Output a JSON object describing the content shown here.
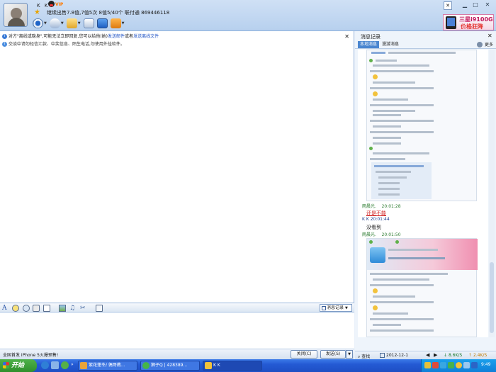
{
  "header": {
    "nickname": "K K",
    "vip_label": "VIP",
    "status_text": "继续出售7.8值,7值5次 8值5/40个 联付通 869446118",
    "toolbar_icons": [
      "video-icon",
      "voice-icon",
      "file-transfer-icon",
      "remote-assist-icon",
      "screen-share-icon",
      "app-box-icon"
    ],
    "ad_line1": "三星i9100G",
    "ad_line2": "价格狂降"
  },
  "notices": {
    "line1_text": "对方\"离线或隐身\",可能无法立即回复,您可以给他(她)",
    "line1_link1": "发送邮件",
    "line1_mid": "或者",
    "line1_link2": "发送离线文件",
    "line2_text": "交谈中请勿轻信汇款、中奖信息、陌生电话,勿使用外挂软件。"
  },
  "input_toolbar": {
    "icons": [
      "font-icon",
      "emoticon-icon",
      "magic-emoticon-icon",
      "shake-icon",
      "handwriting-icon",
      "image-icon",
      "music-icon",
      "screenshot-icon",
      "more-icon"
    ],
    "history_button": "消息记录"
  },
  "bottom_bar": {
    "promo": "全国首发 iPhone 5火爆预售!",
    "close_label": "关闭(C)",
    "send_label": "发送(S)"
  },
  "history": {
    "title": "消息记录",
    "tab_local": "本地消息",
    "tab_roam": "漫游消息",
    "more_label": "更多",
    "entries": [
      {
        "name": "雨晨光.",
        "time": "20:01:28",
        "message": "还是不能",
        "name_style": "green",
        "msg_style": "red"
      },
      {
        "name": "K K",
        "time": "20:01:44",
        "message": "没看到",
        "name_style": "blue",
        "msg_style": "plain"
      },
      {
        "name": "雨晨光.",
        "time": "20:01:50",
        "message": "",
        "name_style": "green",
        "msg_style": "plain"
      }
    ],
    "search_label": "查找",
    "date_value": "2012-12-1",
    "speed_down": "8.6K/S",
    "speed_up": "2.4K/S"
  },
  "taskbar": {
    "start_label": "开始",
    "tasks": [
      "紫花蓬冬/ 偶哥教...",
      "狮子Q | 428389...",
      "K K"
    ],
    "clock": "9:49"
  }
}
